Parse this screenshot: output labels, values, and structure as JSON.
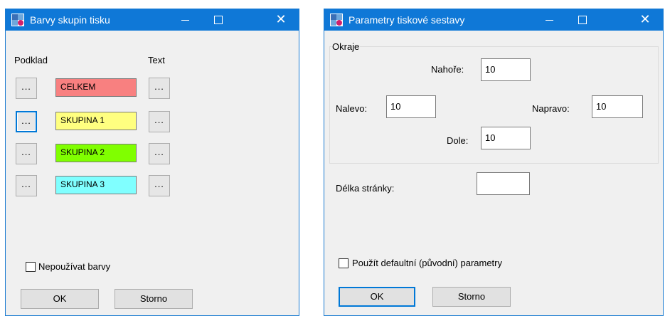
{
  "colors": {
    "titlebar": "#0f78d7",
    "celkem": "#f88080",
    "skupina1": "#ffff80",
    "skupina2": "#80ff00",
    "skupina3": "#80ffff",
    "focus_border": "#0078d7"
  },
  "left_window": {
    "title": "Barvy skupin tisku",
    "col_background_label": "Podklad",
    "col_text_label": "Text",
    "dots_label": "...",
    "rows": [
      {
        "label": "CELKEM"
      },
      {
        "label": "SKUPINA 1"
      },
      {
        "label": "SKUPINA 2"
      },
      {
        "label": "SKUPINA 3"
      }
    ],
    "checkbox_label": "Nepoužívat barvy",
    "checkbox_checked": false,
    "ok_label": "OK",
    "cancel_label": "Storno"
  },
  "right_window": {
    "title": "Parametry tiskové sestavy",
    "margins_group_label": "Okraje",
    "top_label": "Nahoře:",
    "top_value": "10",
    "left_label": "Nalevo:",
    "left_value": "10",
    "right_label": "Napravo:",
    "right_value": "10",
    "bottom_label": "Dole:",
    "bottom_value": "10",
    "page_length_label": "Délka stránky:",
    "page_length_value": "",
    "checkbox_label": "Použít defaultní (původní) parametry",
    "checkbox_checked": false,
    "ok_label": "OK",
    "cancel_label": "Storno"
  },
  "titlebar_buttons": {
    "minimize": "",
    "maximize": "",
    "close": "✕"
  }
}
